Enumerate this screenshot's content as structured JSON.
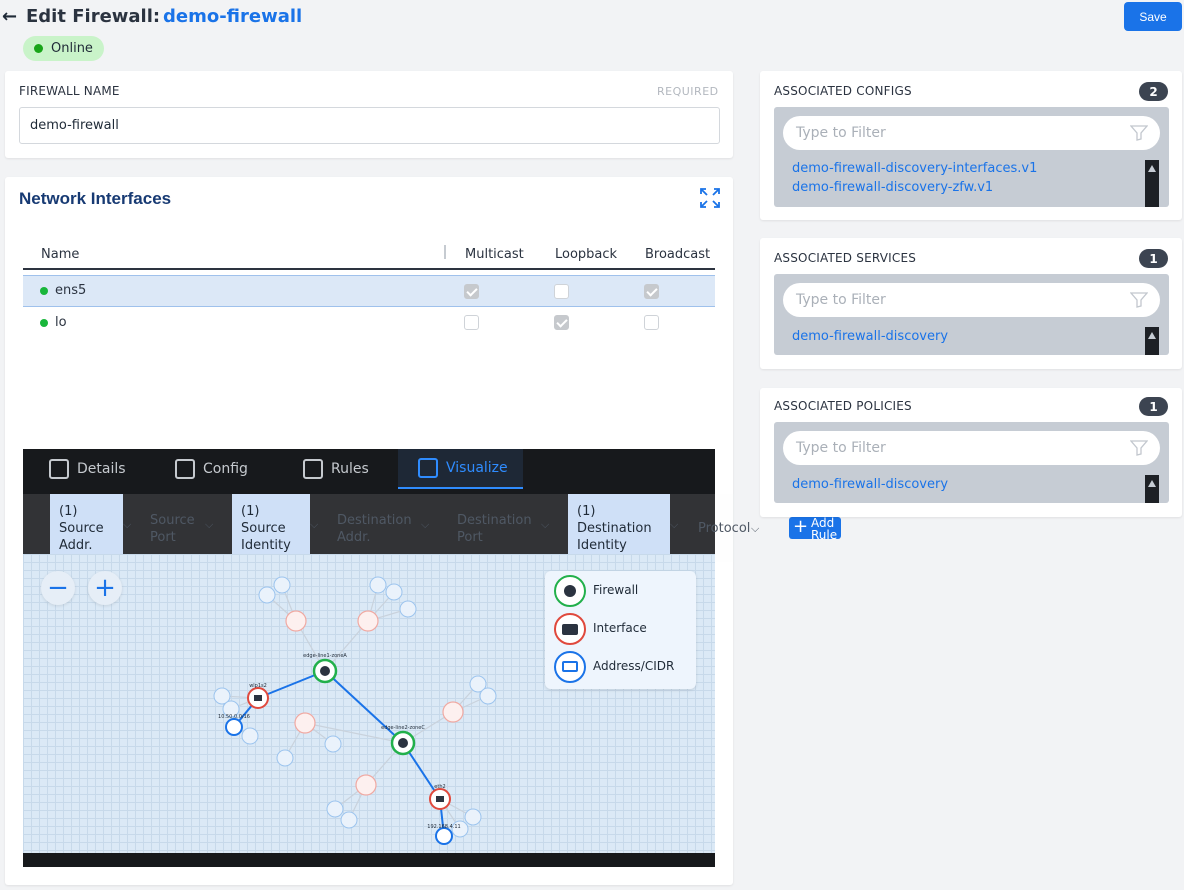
{
  "header": {
    "back_icon": "arrow-left-icon",
    "title": "Edit Firewall:",
    "name": "demo-firewall",
    "save_label": "Save"
  },
  "status": {
    "label": "Online",
    "color": "#19a519"
  },
  "firewall_name": {
    "label": "FIREWALL NAME",
    "required": "REQUIRED",
    "value": "demo-firewall"
  },
  "interfaces": {
    "title": "Network Interfaces",
    "columns": [
      "Name",
      "Multicast",
      "Loopback",
      "Broadcast"
    ],
    "rows": [
      {
        "name": "ens5",
        "multicast": true,
        "loopback": false,
        "broadcast": true
      },
      {
        "name": "lo",
        "multicast": false,
        "loopback": true,
        "broadcast": false
      }
    ]
  },
  "tabs": [
    "Details",
    "Config",
    "Rules",
    "Visualize"
  ],
  "filters": [
    {
      "count": "(1)",
      "label": "Source Addr."
    },
    {
      "label": "Source Port"
    },
    {
      "count": "(1)",
      "label": "Source Identity"
    },
    {
      "label": "Destination Addr."
    },
    {
      "label": "Destination Port"
    },
    {
      "count": "(1)",
      "label": "Destination Identity"
    },
    {
      "label": "Protocol"
    }
  ],
  "add_rule_label": "Add Rule",
  "graph": {
    "node_labels": [
      "edge-line1-zoneA",
      "edge-line2-zoneC",
      "wlp1s2",
      "10.50.0.0/16",
      "eth2",
      "192.168.4.11"
    ]
  },
  "legend": [
    "Firewall",
    "Interface",
    "Address/CIDR"
  ],
  "colors": {
    "firewall": "#22b04b",
    "interface": "#e0493d",
    "address": "#1a73e8",
    "accent": "#1a73e8"
  },
  "configs": {
    "title": "ASSOCIATED CONFIGS",
    "count": "2",
    "placeholder": "Type to Filter",
    "items": [
      "demo-firewall-discovery-interfaces.v1",
      "demo-firewall-discovery-zfw.v1"
    ]
  },
  "services": {
    "title": "ASSOCIATED SERVICES",
    "count": "1",
    "placeholder": "Type to Filter",
    "items": [
      "demo-firewall-discovery"
    ]
  },
  "policies": {
    "title": "ASSOCIATED POLICIES",
    "count": "1",
    "placeholder": "Type to Filter",
    "items": [
      "demo-firewall-discovery"
    ]
  }
}
